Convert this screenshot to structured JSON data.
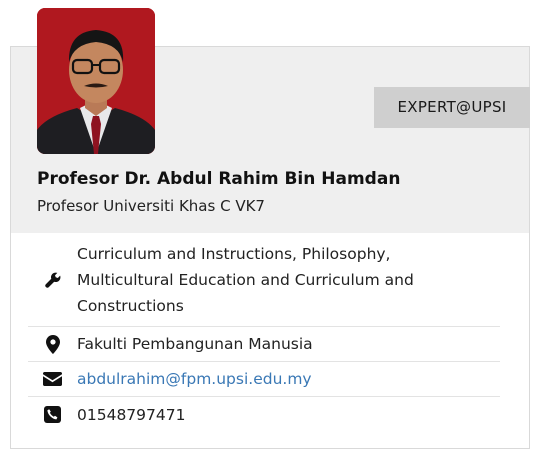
{
  "badge": "EXPERT@UPSI",
  "profile": {
    "name": "Profesor Dr. Abdul Rahim Bin Hamdan",
    "title": "Profesor Universiti Khas C VK7"
  },
  "details": {
    "expertise": "Curriculum and Instructions, Philosophy, Multicultural Education and Curriculum and Constructions",
    "faculty": "Fakulti Pembangunan Manusia",
    "email": "abdulrahim@fpm.upsi.edu.my",
    "phone": "01548797471"
  },
  "icons": {
    "expertise": "wrench-icon",
    "faculty": "map-marker-icon",
    "email": "envelope-icon",
    "phone": "phone-icon"
  },
  "colors": {
    "header_bg": "#efefef",
    "badge_bg": "#cfcfcf",
    "link": "#3a78b5",
    "photo_bg": "#b0181f"
  }
}
